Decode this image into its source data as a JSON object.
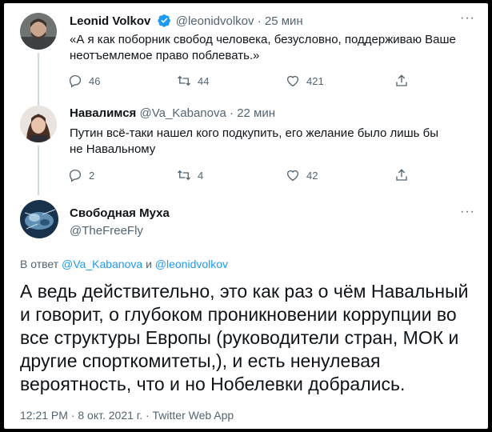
{
  "tweets": [
    {
      "name": "Leonid Volkov",
      "handle": "@leonidvolkov",
      "time": "25 мин",
      "text": "«А я как поборник свобод человека, безусловно, поддерживаю Ваше неотъемлемое право поблевать.»",
      "replies": "46",
      "retweets": "44",
      "likes": "421",
      "verified": true
    },
    {
      "name": "Навалимся",
      "handle": "@Va_Kabanova",
      "time": "22 мин",
      "text": "Путин всё-таки нашел кого подкупить, его желание было лишь бы не Навальному",
      "replies": "2",
      "retweets": "4",
      "likes": "42"
    }
  ],
  "main": {
    "name": "Свободная Муха",
    "handle": "@TheFreeFly",
    "reply_prefix": "В ответ",
    "reply_user1": "@Va_Kabanova",
    "reply_and": "и",
    "reply_user2": "@leonidvolkov",
    "text": "А ведь действительно, это как раз о чём Навальный и говорит, о глубоком проникновении коррупции во все структуры Европы (руководители стран, МОК и другие спорткомитеты,), и есть ненулевая вероятность, что и но Нобелевки добрались.",
    "meta": "12:21 PM · 8 окт. 2021 г. · Twitter Web App"
  },
  "ui": {
    "dot": "·",
    "more": "···"
  },
  "colors": {
    "accent": "#1d9bf0",
    "secondary_text": "#536471",
    "thread_line": "#cfd9de"
  }
}
